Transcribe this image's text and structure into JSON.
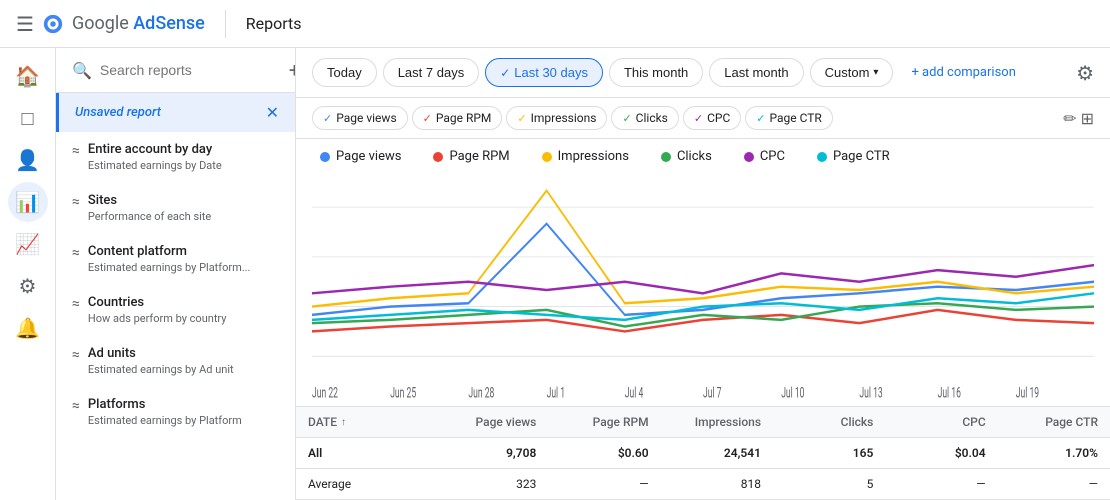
{
  "topbar": {
    "menu_icon": "☰",
    "brand_google": "Google",
    "brand_adsense": "AdSense",
    "page_title": "Reports"
  },
  "filter_bar": {
    "today": "Today",
    "last_7_days": "Last 7 days",
    "last_30_days": "Last 30 days",
    "this_month": "This month",
    "last_month": "Last month",
    "custom": "Custom",
    "add_comparison": "+ add comparison",
    "settings_icon": "⚙"
  },
  "metrics": [
    {
      "label": "Page views",
      "color": "#4285f4",
      "checked": true
    },
    {
      "label": "Page RPM",
      "color": "#ea4335",
      "checked": true
    },
    {
      "label": "Impressions",
      "color": "#fbbc04",
      "checked": true
    },
    {
      "label": "Clicks",
      "color": "#34a853",
      "checked": true
    },
    {
      "label": "CPC",
      "color": "#9c27b0",
      "checked": true
    },
    {
      "label": "Page CTR",
      "color": "#00bcd4",
      "checked": true
    }
  ],
  "legend": [
    {
      "label": "Page views",
      "color": "#4285f4"
    },
    {
      "label": "Page RPM",
      "color": "#ea4335"
    },
    {
      "label": "Impressions",
      "color": "#fbbc04"
    },
    {
      "label": "Clicks",
      "color": "#34a853"
    },
    {
      "label": "CPC",
      "color": "#9c27b0"
    },
    {
      "label": "Page CTR",
      "color": "#00bcd4"
    }
  ],
  "chart_labels": [
    "Jun 22",
    "Jun 25",
    "Jun 28",
    "Jul 1",
    "Jul 4",
    "Jul 7",
    "Jul 10",
    "Jul 13",
    "Jul 16",
    "Jul 19"
  ],
  "table": {
    "headers": [
      "DATE",
      "Page views",
      "Page RPM",
      "Impressions",
      "Clicks",
      "CPC",
      "Page CTR"
    ],
    "rows": [
      {
        "date": "All",
        "page_views": "9,708",
        "page_rpm": "$0.60",
        "impressions": "24,541",
        "clicks": "165",
        "cpc": "$0.04",
        "page_ctr": "1.70%"
      },
      {
        "date": "Average",
        "page_views": "323",
        "page_rpm": "—",
        "impressions": "818",
        "clicks": "5",
        "cpc": "—",
        "page_ctr": "—"
      }
    ]
  },
  "sidebar": {
    "search_placeholder": "Search reports",
    "unsaved_report": "Unsaved report",
    "items": [
      {
        "title": "Entire account by day",
        "subtitle": "Estimated earnings by Date",
        "icon": "≈"
      },
      {
        "title": "Sites",
        "subtitle": "Performance of each site",
        "icon": "≈"
      },
      {
        "title": "Content platform",
        "subtitle": "Estimated earnings by Platform...",
        "icon": "≈"
      },
      {
        "title": "Countries",
        "subtitle": "How ads perform by country",
        "icon": "≈"
      },
      {
        "title": "Ad units",
        "subtitle": "Estimated earnings by Ad unit",
        "icon": "≈"
      },
      {
        "title": "Platforms",
        "subtitle": "Estimated earnings by Platform",
        "icon": "≈"
      }
    ]
  },
  "nav_icons": [
    "⊞",
    "🏠",
    "□",
    "👤",
    "📊",
    "📈",
    "⚙",
    "🔔"
  ]
}
